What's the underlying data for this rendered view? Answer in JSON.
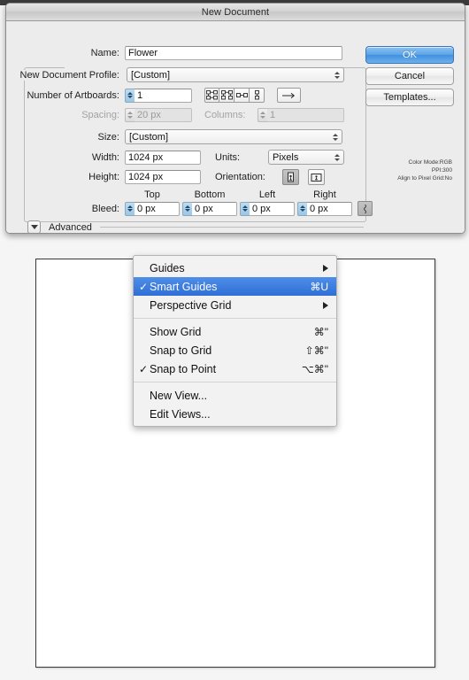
{
  "dialog": {
    "title": "New Document",
    "fields": {
      "name_label": "Name:",
      "name_value": "Flower",
      "profile_label": "New Document Profile:",
      "profile_value": "[Custom]",
      "artboards_label": "Number of Artboards:",
      "artboards_value": "1",
      "spacing_label": "Spacing:",
      "spacing_value": "20 px",
      "columns_label": "Columns:",
      "columns_value": "1",
      "size_label": "Size:",
      "size_value": "[Custom]",
      "width_label": "Width:",
      "width_value": "1024 px",
      "height_label": "Height:",
      "height_value": "1024 px",
      "units_label": "Units:",
      "units_value": "Pixels",
      "orientation_label": "Orientation:",
      "bleed_label": "Bleed:",
      "bleed_top_header": "Top",
      "bleed_bottom_header": "Bottom",
      "bleed_left_header": "Left",
      "bleed_right_header": "Right",
      "bleed_top_value": "0 px",
      "bleed_bottom_value": "0 px",
      "bleed_left_value": "0 px",
      "bleed_right_value": "0 px",
      "advanced_label": "Advanced"
    },
    "buttons": {
      "ok": "OK",
      "cancel": "Cancel",
      "templates": "Templates..."
    },
    "summary": {
      "color_mode": "Color Mode:RGB",
      "ppi": "PPI:300",
      "align_pixel_grid": "Align to Pixel Grid:No"
    },
    "icons": {
      "artboard_grid_rows": "artboard-grid-by-row-icon",
      "artboard_grid_cols": "artboard-grid-by-column-icon",
      "artboard_row": "artboard-single-row-icon",
      "artboard_column": "artboard-single-column-icon",
      "artboard_direction": "artboard-flow-direction-icon",
      "orientation_portrait": "orientation-portrait-icon",
      "orientation_landscape": "orientation-landscape-icon",
      "bleed_link": "bleed-link-icon",
      "advanced_disclosure": "disclosure-triangle-icon"
    }
  },
  "menu": {
    "items": [
      {
        "label": "Guides",
        "checked": false,
        "accel": "",
        "submenu": true,
        "selected": false
      },
      {
        "label": "Smart Guides",
        "checked": true,
        "accel": "⌘U",
        "submenu": false,
        "selected": true
      },
      {
        "label": "Perspective Grid",
        "checked": false,
        "accel": "",
        "submenu": true,
        "selected": false
      },
      {
        "label": "Show Grid",
        "checked": false,
        "accel": "⌘\"",
        "submenu": false,
        "selected": false
      },
      {
        "label": "Snap to Grid",
        "checked": false,
        "accel": "⇧⌘\"",
        "submenu": false,
        "selected": false
      },
      {
        "label": "Snap to Point",
        "checked": true,
        "accel": "⌥⌘\"",
        "submenu": false,
        "selected": false
      },
      {
        "label": "New View...",
        "checked": false,
        "accel": "",
        "submenu": false,
        "selected": false
      },
      {
        "label": "Edit Views...",
        "checked": false,
        "accel": "",
        "submenu": false,
        "selected": false
      }
    ],
    "separators_after": [
      2,
      5
    ],
    "checkmark": "✓",
    "highlight_color": "#2f6fd6"
  },
  "canvas": {
    "artboard_name": "artboard"
  }
}
